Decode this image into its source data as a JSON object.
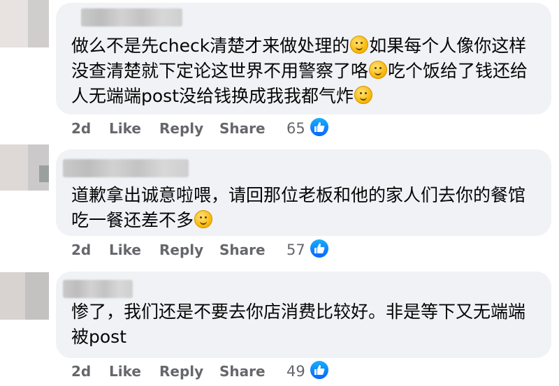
{
  "comments": [
    {
      "text_parts": [
        "做么不是先check清楚才来做处理的",
        "如果每个人像你这样没查清楚就下定论这世界不用警察了咯",
        "吃个饭给了钱还给人无端端post没给钱换成我我都气炸",
        ""
      ],
      "time": "2d",
      "like_label": "Like",
      "reply_label": "Reply",
      "share_label": "Share",
      "reaction_count": "65"
    },
    {
      "text_parts": [
        "道歉拿出诚意啦喂，请回那位老板和他的家人们去你的餐馆吃一餐还差不多",
        ""
      ],
      "time": "2d",
      "like_label": "Like",
      "reply_label": "Reply",
      "share_label": "Share",
      "reaction_count": "57"
    },
    {
      "text_parts": [
        "惨了，我们还是不要去你店消费比较好。非是等下又无端端被post"
      ],
      "time": "2d",
      "like_label": "Like",
      "reply_label": "Reply",
      "share_label": "Share",
      "reaction_count": "49"
    }
  ],
  "icons": {
    "reaction": "like-thumb-icon",
    "emoji": "smiley-emoji-icon",
    "reaction_color": "#0866ff",
    "bubble_color": "#f0f2f5",
    "meta_color": "#65676b"
  }
}
